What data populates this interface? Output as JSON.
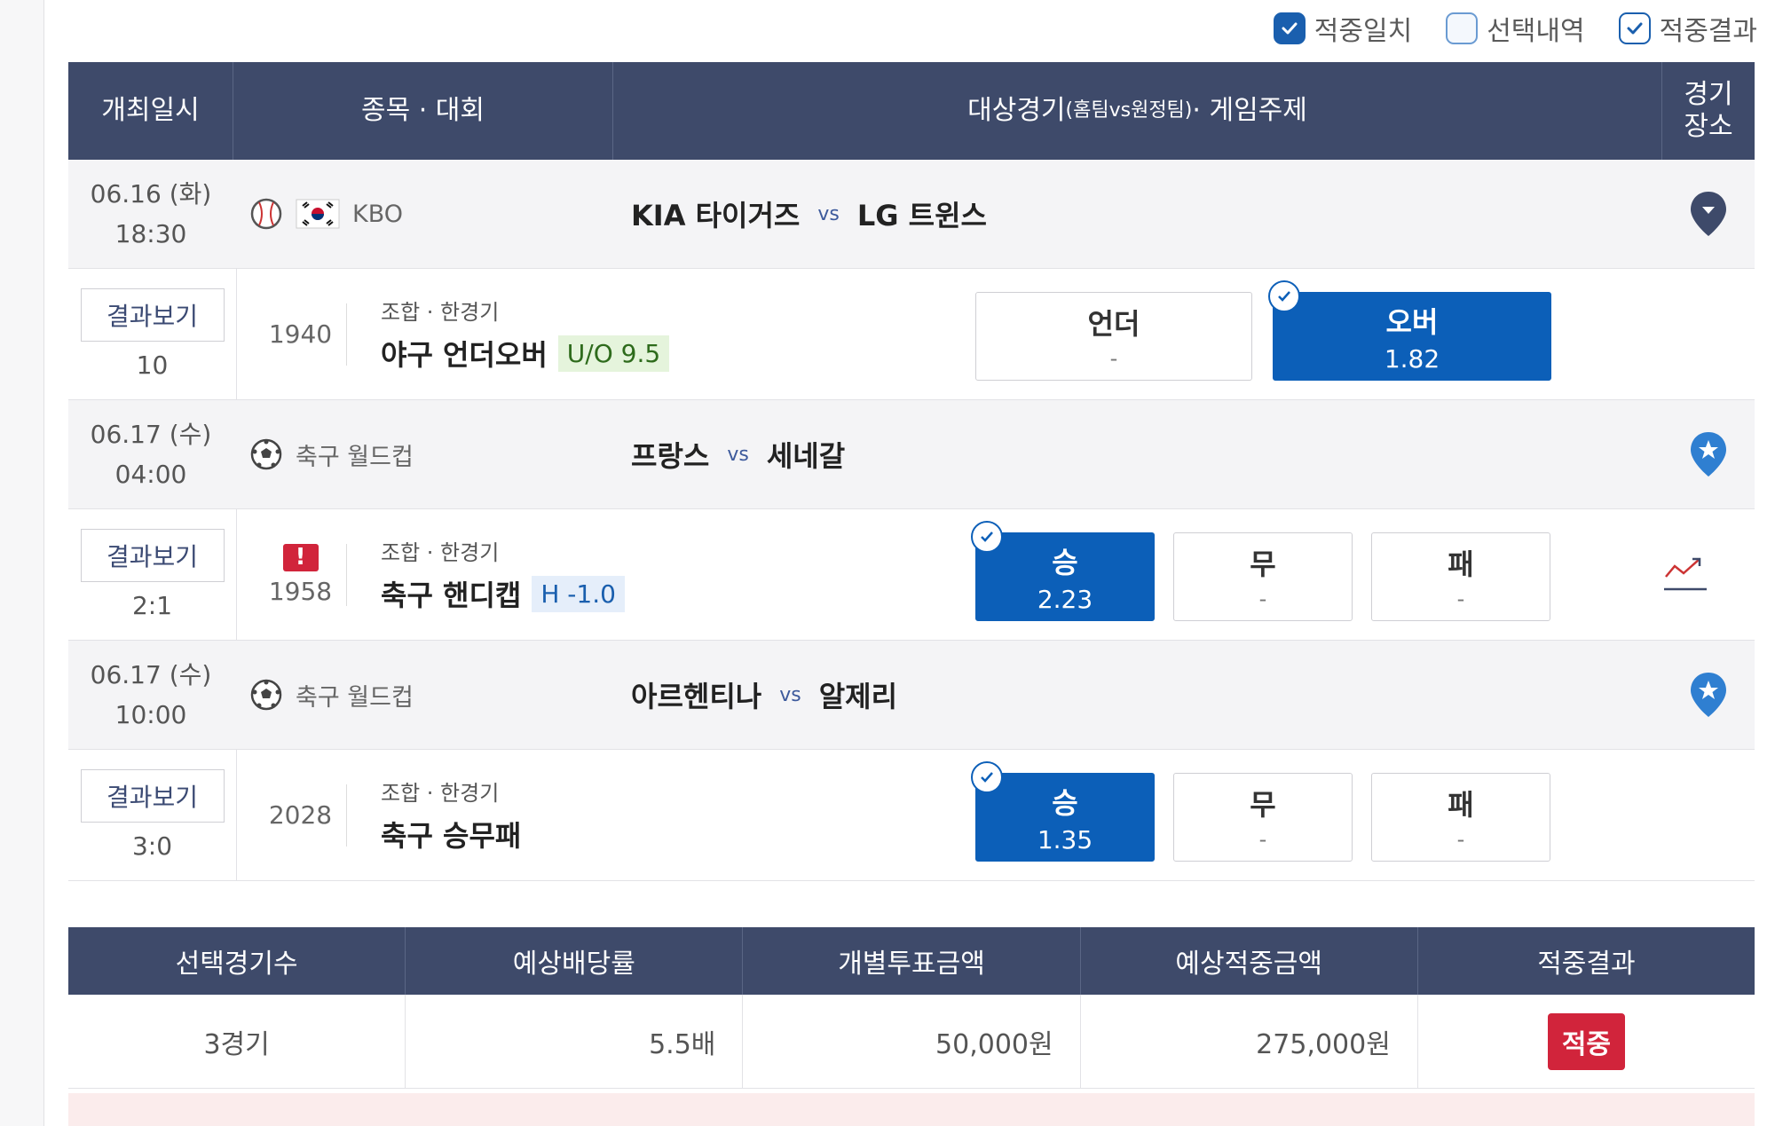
{
  "filters": [
    {
      "label": "적중일치",
      "state": "filled"
    },
    {
      "label": "선택내역",
      "state": "empty"
    },
    {
      "label": "적중결과",
      "state": "outline"
    }
  ],
  "table_header": {
    "date": "개최일시",
    "sport": "종목 · 대회",
    "match_main": "대상경기",
    "match_small": "(홈팀vs원정팀)",
    "match_tail": " · 게임주제",
    "venue_line1": "경기",
    "venue_line2": "장소"
  },
  "vs": "vs",
  "result_button": "결과보기",
  "games": [
    {
      "date": "06.16 (화)",
      "time": "18:30",
      "league": "KBO",
      "sport_icon": "baseball-icon",
      "flag": "korea-flag-icon",
      "home": "KIA 타이거즈",
      "away": "LG 트윈스",
      "venue_icon": "map-pin-dark-icon",
      "score": "10",
      "game_no": "1940",
      "alert": "",
      "bet_type": "조합 · 한경기",
      "bet_name": "야구 언더오버",
      "tag": "U/O 9.5",
      "odds": [
        {
          "label": "언더",
          "value": "-",
          "selected": false
        },
        {
          "label": "오버",
          "value": "1.82",
          "selected": true
        }
      ]
    },
    {
      "date": "06.17 (수)",
      "time": "04:00",
      "league": "축구 월드컵",
      "sport_icon": "soccer-ball-icon",
      "home": "프랑스",
      "away": "세네갈",
      "venue_icon": "map-pin-star-icon",
      "score": "2:1",
      "game_no": "1958",
      "alert": "!",
      "bet_type": "조합 · 한경기",
      "bet_name": "축구 핸디캡",
      "tag": "H -1.0",
      "odds": [
        {
          "label": "승",
          "value": "2.23",
          "selected": true
        },
        {
          "label": "무",
          "value": "-",
          "selected": false
        },
        {
          "label": "패",
          "value": "-",
          "selected": false
        }
      ]
    },
    {
      "date": "06.17 (수)",
      "time": "10:00",
      "league": "축구 월드컵",
      "sport_icon": "soccer-ball-icon",
      "home": "아르헨티나",
      "away": "알제리",
      "venue_icon": "map-pin-star-icon",
      "score": "3:0",
      "game_no": "2028",
      "alert": "",
      "bet_type": "조합 · 한경기",
      "bet_name": "축구 승무패",
      "tag": "",
      "odds": [
        {
          "label": "승",
          "value": "1.35",
          "selected": true
        },
        {
          "label": "무",
          "value": "-",
          "selected": false
        },
        {
          "label": "패",
          "value": "-",
          "selected": false
        }
      ]
    }
  ],
  "summary": {
    "headers": [
      "선택경기수",
      "예상배당률",
      "개별투표금액",
      "예상적중금액",
      "적중결과"
    ],
    "values": {
      "games": "3경기",
      "odds": "5.5배",
      "stake": "50,000원",
      "payout": "275,000원",
      "result": "적중"
    }
  },
  "colors": {
    "header": "#3e4a6a",
    "selected": "#0c5fb8",
    "hit": "#d1243b"
  }
}
